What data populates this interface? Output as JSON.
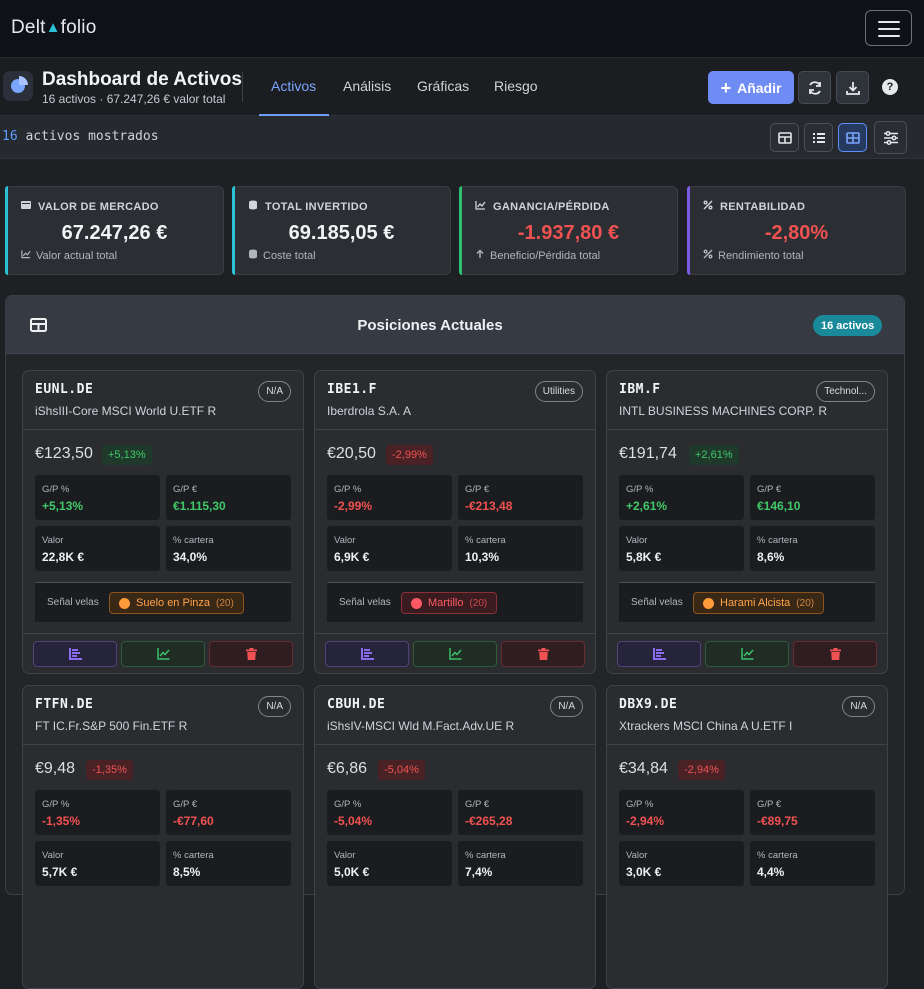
{
  "brand": {
    "prefix": "Delt",
    "glyph": "▲",
    "suffix": "folio"
  },
  "header": {
    "title": "Dashboard de Activos",
    "subtitle": "16 activos · 67.247,26 € valor total",
    "tabs": [
      "Activos",
      "Análisis",
      "Gráficas",
      "Riesgo"
    ],
    "active_tab": "Activos",
    "add_label": "Añadir",
    "help_label": "?"
  },
  "filterbar": {
    "count": "16",
    "label": "activos mostrados"
  },
  "stats": [
    {
      "label": "VALOR DE MERCADO",
      "value": "67.247,26 €",
      "foot": "Valor actual total",
      "accent": "#2bc1d6",
      "negative": false
    },
    {
      "label": "TOTAL INVERTIDO",
      "value": "69.185,05 €",
      "foot": "Coste total",
      "accent": "#2bc1d6",
      "negative": false
    },
    {
      "label": "GANANCIA/PÉRDIDA",
      "value": "-1.937,80 €",
      "foot": "Beneficio/Pérdida total",
      "accent": "#2fbf71",
      "negative": true
    },
    {
      "label": "RENTABILIDAD",
      "value": "-2,80%",
      "foot": "Rendimiento total",
      "accent": "#7c5ce6",
      "negative": true
    }
  ],
  "panel": {
    "title": "Posiciones Actuales",
    "badge": "16 activos"
  },
  "metric_labels": {
    "gp_pct": "G/P %",
    "gp_eur": "G/P €",
    "value": "Valor",
    "weight": "% cartera",
    "signal": "Señal velas"
  },
  "cards": [
    {
      "ticker": "EUNL.DE",
      "name": "iShsIII-Core MSCI World U.ETF R",
      "sector": "N/A",
      "price": "€123,50",
      "change": "+5,13%",
      "positive": true,
      "gp_pct": "+5,13%",
      "gp_eur": "€1.115,30",
      "value": "22,8K €",
      "weight": "34,0%",
      "signal": {
        "name": "Suelo en Pinza",
        "strength": "(20)",
        "tone": "orange"
      }
    },
    {
      "ticker": "IBE1.F",
      "name": "Iberdrola S.A. A",
      "sector": "Utilities",
      "price": "€20,50",
      "change": "-2,99%",
      "positive": false,
      "gp_pct": "-2,99%",
      "gp_eur": "-€213,48",
      "value": "6,9K €",
      "weight": "10,3%",
      "signal": {
        "name": "Martillo",
        "strength": "(20)",
        "tone": "red"
      }
    },
    {
      "ticker": "IBM.F",
      "name": "INTL BUSINESS MACHINES CORP. R",
      "sector": "Technol...",
      "price": "€191,74",
      "change": "+2,61%",
      "positive": true,
      "gp_pct": "+2,61%",
      "gp_eur": "€146,10",
      "value": "5,8K €",
      "weight": "8,6%",
      "signal": {
        "name": "Harami Alcista",
        "strength": "(20)",
        "tone": "orange"
      }
    },
    {
      "ticker": "FTFN.DE",
      "name": "FT IC.Fr.S&P 500 Fin.ETF R",
      "sector": "N/A",
      "price": "€9,48",
      "change": "-1,35%",
      "positive": false,
      "gp_pct": "-1,35%",
      "gp_eur": "-€77,60",
      "value": "5,7K €",
      "weight": "8,5%",
      "signal": null
    },
    {
      "ticker": "CBUH.DE",
      "name": "iShsIV-MSCI Wld M.Fact.Adv.UE R",
      "sector": "N/A",
      "price": "€6,86",
      "change": "-5,04%",
      "positive": false,
      "gp_pct": "-5,04%",
      "gp_eur": "-€265,28",
      "value": "5,0K €",
      "weight": "7,4%",
      "signal": null
    },
    {
      "ticker": "DBX9.DE",
      "name": "Xtrackers MSCI China A U.ETF I",
      "sector": "N/A",
      "price": "€34,84",
      "change": "-2,94%",
      "positive": false,
      "gp_pct": "-2,94%",
      "gp_eur": "-€89,75",
      "value": "3,0K €",
      "weight": "4,4%",
      "signal": null
    }
  ]
}
